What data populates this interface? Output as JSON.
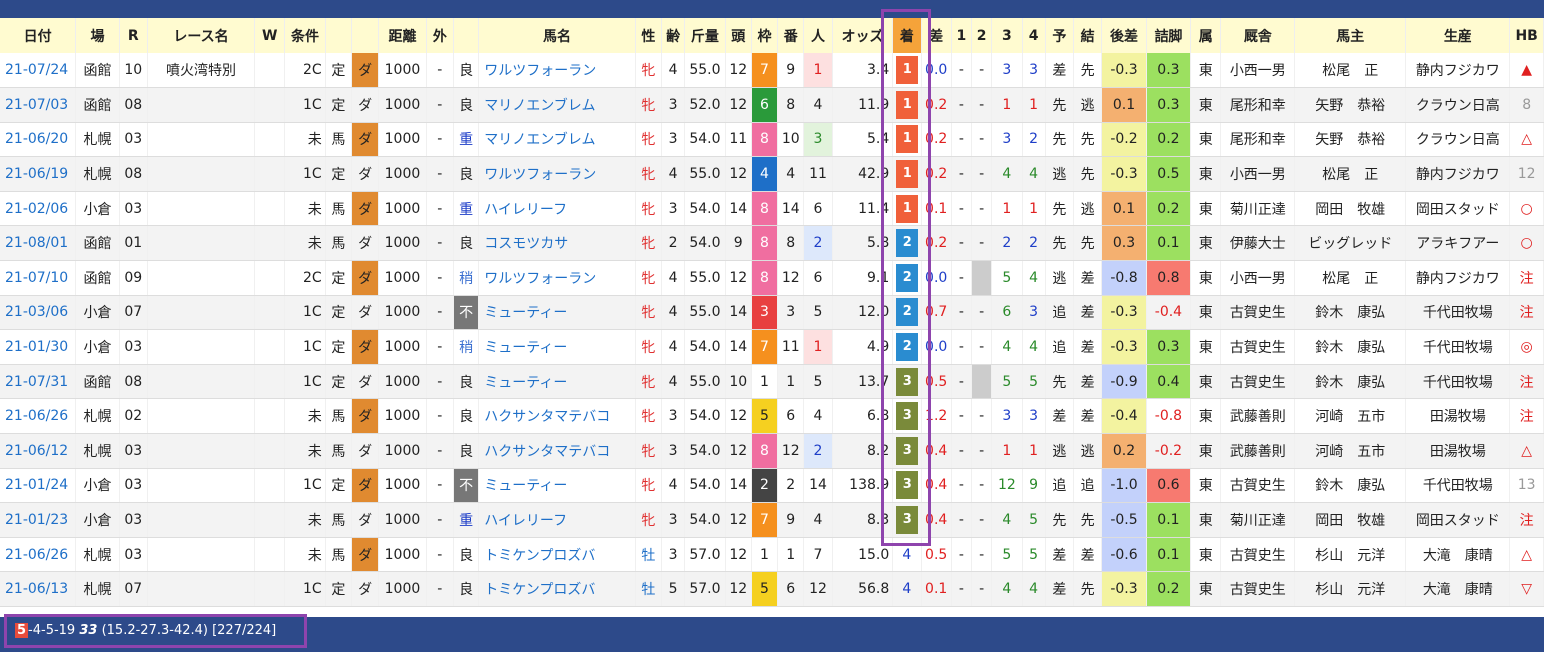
{
  "headers": [
    "日付",
    "場",
    "R",
    "レース名",
    "W",
    "条件",
    "",
    "",
    "距離",
    "外",
    "",
    "馬名",
    "性",
    "齢",
    "斤量",
    "頭",
    "枠",
    "番",
    "人",
    "オッズ",
    "着",
    "差",
    "1",
    "2",
    "3",
    "4",
    "予",
    "結",
    "後差",
    "詰脚",
    "属",
    "厩舎",
    "馬主",
    "生産",
    "HB"
  ],
  "rows": [
    {
      "date": "21-07/24",
      "venue": "函館",
      "r": "10",
      "race": "噴火湾特別",
      "w": "",
      "cls": "2C",
      "kind": "定",
      "surf": "ダ",
      "dist": "1000",
      "out": "-",
      "cond": "良",
      "horse": "ワルツフォーラン",
      "sex": "牝",
      "age": "4",
      "wt": "55.0",
      "n": "12",
      "waku": "7",
      "ban": "9",
      "pop": "1",
      "odds": "3.4",
      "finish": "1",
      "diff": "0.0",
      "c1": "-",
      "c2": "-",
      "c3": "3",
      "c4": "3",
      "yo": "差",
      "ke": "先",
      "ato": "-0.3",
      "tsume": "0.3",
      "zoku": "東",
      "trainer": "小西一男",
      "owner": "松尾　正",
      "breeder": "静内フジカワ",
      "hb": "▲"
    },
    {
      "date": "21-07/03",
      "venue": "函館",
      "r": "08",
      "race": "",
      "w": "",
      "cls": "1C",
      "kind": "定",
      "surf": "ダ",
      "dist": "1000",
      "out": "-",
      "cond": "良",
      "horse": "マリノエンブレム",
      "sex": "牝",
      "age": "3",
      "wt": "52.0",
      "n": "12",
      "waku": "6",
      "ban": "8",
      "pop": "4",
      "odds": "11.9",
      "finish": "1",
      "diff": "0.2",
      "c1": "-",
      "c2": "-",
      "c3": "1",
      "c4": "1",
      "yo": "先",
      "ke": "逃",
      "ato": "0.1",
      "tsume": "0.3",
      "zoku": "東",
      "trainer": "尾形和幸",
      "owner": "矢野　恭裕",
      "breeder": "クラウン日高",
      "hb": "8"
    },
    {
      "date": "21-06/20",
      "venue": "札幌",
      "r": "03",
      "race": "",
      "w": "",
      "cls": "未",
      "kind": "馬",
      "surf": "ダ",
      "dist": "1000",
      "out": "-",
      "cond": "重",
      "horse": "マリノエンブレム",
      "sex": "牝",
      "age": "3",
      "wt": "54.0",
      "n": "11",
      "waku": "8",
      "ban": "10",
      "pop": "3",
      "odds": "5.4",
      "finish": "1",
      "diff": "0.2",
      "c1": "-",
      "c2": "-",
      "c3": "3",
      "c4": "2",
      "yo": "先",
      "ke": "先",
      "ato": "-0.2",
      "tsume": "0.2",
      "zoku": "東",
      "trainer": "尾形和幸",
      "owner": "矢野　恭裕",
      "breeder": "クラウン日高",
      "hb": "△"
    },
    {
      "date": "21-06/19",
      "venue": "札幌",
      "r": "08",
      "race": "",
      "w": "",
      "cls": "1C",
      "kind": "定",
      "surf": "ダ",
      "dist": "1000",
      "out": "-",
      "cond": "良",
      "horse": "ワルツフォーラン",
      "sex": "牝",
      "age": "4",
      "wt": "55.0",
      "n": "12",
      "waku": "4",
      "ban": "4",
      "pop": "11",
      "odds": "42.9",
      "finish": "1",
      "diff": "0.2",
      "c1": "-",
      "c2": "-",
      "c3": "4",
      "c4": "4",
      "yo": "逃",
      "ke": "先",
      "ato": "-0.3",
      "tsume": "0.5",
      "zoku": "東",
      "trainer": "小西一男",
      "owner": "松尾　正",
      "breeder": "静内フジカワ",
      "hb": "12"
    },
    {
      "date": "21-02/06",
      "venue": "小倉",
      "r": "03",
      "race": "",
      "w": "",
      "cls": "未",
      "kind": "馬",
      "surf": "ダ",
      "dist": "1000",
      "out": "-",
      "cond": "重",
      "horse": "ハイレリーフ",
      "sex": "牝",
      "age": "3",
      "wt": "54.0",
      "n": "14",
      "waku": "8",
      "ban": "14",
      "pop": "6",
      "odds": "11.4",
      "finish": "1",
      "diff": "0.1",
      "c1": "-",
      "c2": "-",
      "c3": "1",
      "c4": "1",
      "yo": "先",
      "ke": "逃",
      "ato": "0.1",
      "tsume": "0.2",
      "zoku": "東",
      "trainer": "菊川正達",
      "owner": "岡田　牧雄",
      "breeder": "岡田スタッド",
      "hb": "○"
    },
    {
      "date": "21-08/01",
      "venue": "函館",
      "r": "01",
      "race": "",
      "w": "",
      "cls": "未",
      "kind": "馬",
      "surf": "ダ",
      "dist": "1000",
      "out": "-",
      "cond": "良",
      "horse": "コスモツカサ",
      "sex": "牝",
      "age": "2",
      "wt": "54.0",
      "n": "9",
      "waku": "8",
      "ban": "8",
      "pop": "2",
      "odds": "5.8",
      "finish": "2",
      "diff": "0.2",
      "c1": "-",
      "c2": "-",
      "c3": "2",
      "c4": "2",
      "yo": "先",
      "ke": "先",
      "ato": "0.3",
      "tsume": "0.1",
      "zoku": "東",
      "trainer": "伊藤大士",
      "owner": "ビッグレッド",
      "breeder": "アラキフアー",
      "hb": "○"
    },
    {
      "date": "21-07/10",
      "venue": "函館",
      "r": "09",
      "race": "",
      "w": "",
      "cls": "2C",
      "kind": "定",
      "surf": "ダ",
      "dist": "1000",
      "out": "-",
      "cond": "稍",
      "horse": "ワルツフォーラン",
      "sex": "牝",
      "age": "4",
      "wt": "55.0",
      "n": "12",
      "waku": "8",
      "ban": "12",
      "pop": "6",
      "odds": "9.1",
      "finish": "2",
      "diff": "0.0",
      "c1": "-",
      "c2": "",
      "c3": "5",
      "c4": "4",
      "yo": "逃",
      "ke": "差",
      "ato": "-0.8",
      "tsume": "0.8",
      "zoku": "東",
      "trainer": "小西一男",
      "owner": "松尾　正",
      "breeder": "静内フジカワ",
      "hb": "注"
    },
    {
      "date": "21-03/06",
      "venue": "小倉",
      "r": "07",
      "race": "",
      "w": "",
      "cls": "1C",
      "kind": "定",
      "surf": "ダ",
      "dist": "1000",
      "out": "-",
      "cond": "不",
      "horse": "ミューティー",
      "sex": "牝",
      "age": "4",
      "wt": "55.0",
      "n": "14",
      "waku": "3",
      "ban": "3",
      "pop": "5",
      "odds": "12.0",
      "finish": "2",
      "diff": "0.7",
      "c1": "-",
      "c2": "-",
      "c3": "6",
      "c4": "3",
      "yo": "追",
      "ke": "差",
      "ato": "-0.3",
      "tsume": "-0.4",
      "zoku": "東",
      "trainer": "古賀史生",
      "owner": "鈴木　康弘",
      "breeder": "千代田牧場",
      "hb": "注"
    },
    {
      "date": "21-01/30",
      "venue": "小倉",
      "r": "03",
      "race": "",
      "w": "",
      "cls": "1C",
      "kind": "定",
      "surf": "ダ",
      "dist": "1000",
      "out": "-",
      "cond": "稍",
      "horse": "ミューティー",
      "sex": "牝",
      "age": "4",
      "wt": "54.0",
      "n": "14",
      "waku": "7",
      "ban": "11",
      "pop": "1",
      "odds": "4.9",
      "finish": "2",
      "diff": "0.0",
      "c1": "-",
      "c2": "-",
      "c3": "4",
      "c4": "4",
      "yo": "追",
      "ke": "差",
      "ato": "-0.3",
      "tsume": "0.3",
      "zoku": "東",
      "trainer": "古賀史生",
      "owner": "鈴木　康弘",
      "breeder": "千代田牧場",
      "hb": "◎"
    },
    {
      "date": "21-07/31",
      "venue": "函館",
      "r": "08",
      "race": "",
      "w": "",
      "cls": "1C",
      "kind": "定",
      "surf": "ダ",
      "dist": "1000",
      "out": "-",
      "cond": "良",
      "horse": "ミューティー",
      "sex": "牝",
      "age": "4",
      "wt": "55.0",
      "n": "10",
      "waku": "1",
      "ban": "1",
      "pop": "5",
      "odds": "13.7",
      "finish": "3",
      "diff": "0.5",
      "c1": "-",
      "c2": "",
      "c3": "5",
      "c4": "5",
      "yo": "先",
      "ke": "差",
      "ato": "-0.9",
      "tsume": "0.4",
      "zoku": "東",
      "trainer": "古賀史生",
      "owner": "鈴木　康弘",
      "breeder": "千代田牧場",
      "hb": "注"
    },
    {
      "date": "21-06/26",
      "venue": "札幌",
      "r": "02",
      "race": "",
      "w": "",
      "cls": "未",
      "kind": "馬",
      "surf": "ダ",
      "dist": "1000",
      "out": "-",
      "cond": "良",
      "horse": "ハクサンタマテバコ",
      "sex": "牝",
      "age": "3",
      "wt": "54.0",
      "n": "12",
      "waku": "5",
      "ban": "6",
      "pop": "4",
      "odds": "6.8",
      "finish": "3",
      "diff": "1.2",
      "c1": "-",
      "c2": "-",
      "c3": "3",
      "c4": "3",
      "yo": "差",
      "ke": "差",
      "ato": "-0.4",
      "tsume": "-0.8",
      "zoku": "東",
      "trainer": "武藤善則",
      "owner": "河崎　五市",
      "breeder": "田湯牧場",
      "hb": "注"
    },
    {
      "date": "21-06/12",
      "venue": "札幌",
      "r": "03",
      "race": "",
      "w": "",
      "cls": "未",
      "kind": "馬",
      "surf": "ダ",
      "dist": "1000",
      "out": "-",
      "cond": "良",
      "horse": "ハクサンタマテバコ",
      "sex": "牝",
      "age": "3",
      "wt": "54.0",
      "n": "12",
      "waku": "8",
      "ban": "12",
      "pop": "2",
      "odds": "8.2",
      "finish": "3",
      "diff": "0.4",
      "c1": "-",
      "c2": "-",
      "c3": "1",
      "c4": "1",
      "yo": "逃",
      "ke": "逃",
      "ato": "0.2",
      "tsume": "-0.2",
      "zoku": "東",
      "trainer": "武藤善則",
      "owner": "河崎　五市",
      "breeder": "田湯牧場",
      "hb": "△"
    },
    {
      "date": "21-01/24",
      "venue": "小倉",
      "r": "03",
      "race": "",
      "w": "",
      "cls": "1C",
      "kind": "定",
      "surf": "ダ",
      "dist": "1000",
      "out": "-",
      "cond": "不",
      "horse": "ミューティー",
      "sex": "牝",
      "age": "4",
      "wt": "54.0",
      "n": "14",
      "waku": "2",
      "ban": "2",
      "pop": "14",
      "odds": "138.9",
      "finish": "3",
      "diff": "0.4",
      "c1": "-",
      "c2": "-",
      "c3": "12",
      "c4": "9",
      "yo": "追",
      "ke": "追",
      "ato": "-1.0",
      "tsume": "0.6",
      "zoku": "東",
      "trainer": "古賀史生",
      "owner": "鈴木　康弘",
      "breeder": "千代田牧場",
      "hb": "13"
    },
    {
      "date": "21-01/23",
      "venue": "小倉",
      "r": "03",
      "race": "",
      "w": "",
      "cls": "未",
      "kind": "馬",
      "surf": "ダ",
      "dist": "1000",
      "out": "-",
      "cond": "重",
      "horse": "ハイレリーフ",
      "sex": "牝",
      "age": "3",
      "wt": "54.0",
      "n": "12",
      "waku": "7",
      "ban": "9",
      "pop": "4",
      "odds": "8.3",
      "finish": "3",
      "diff": "0.4",
      "c1": "-",
      "c2": "-",
      "c3": "4",
      "c4": "5",
      "yo": "先",
      "ke": "先",
      "ato": "-0.5",
      "tsume": "0.1",
      "zoku": "東",
      "trainer": "菊川正達",
      "owner": "岡田　牧雄",
      "breeder": "岡田スタッド",
      "hb": "注"
    },
    {
      "date": "21-06/26",
      "venue": "札幌",
      "r": "03",
      "race": "",
      "w": "",
      "cls": "未",
      "kind": "馬",
      "surf": "ダ",
      "dist": "1000",
      "out": "-",
      "cond": "良",
      "horse": "トミケンプロズバ",
      "sex": "牡",
      "age": "3",
      "wt": "57.0",
      "n": "12",
      "waku": "1",
      "ban": "1",
      "pop": "7",
      "odds": "15.0",
      "finish": "4",
      "diff": "0.5",
      "c1": "-",
      "c2": "-",
      "c3": "5",
      "c4": "5",
      "yo": "差",
      "ke": "差",
      "ato": "-0.6",
      "tsume": "0.1",
      "zoku": "東",
      "trainer": "古賀史生",
      "owner": "杉山　元洋",
      "breeder": "大滝　康晴",
      "hb": "△"
    },
    {
      "date": "21-06/13",
      "venue": "札幌",
      "r": "07",
      "race": "",
      "w": "",
      "cls": "1C",
      "kind": "定",
      "surf": "ダ",
      "dist": "1000",
      "out": "-",
      "cond": "良",
      "horse": "トミケンプロズバ",
      "sex": "牡",
      "age": "5",
      "wt": "57.0",
      "n": "12",
      "waku": "5",
      "ban": "6",
      "pop": "12",
      "odds": "56.8",
      "finish": "4",
      "diff": "0.1",
      "c1": "-",
      "c2": "-",
      "c3": "4",
      "c4": "4",
      "yo": "差",
      "ke": "先",
      "ato": "-0.3",
      "tsume": "0.2",
      "zoku": "東",
      "trainer": "古賀史生",
      "owner": "杉山　元洋",
      "breeder": "大滝　康晴",
      "hb": "▽"
    }
  ],
  "summary": {
    "first": "5",
    "rest": "-4-5-19",
    "total": "33",
    "detail": "(15.2-27.3-42.4) [227/224]"
  },
  "colors": {
    "header_bg": "#fffbd0",
    "bar": "#2d4a8a",
    "highlight": "#8e44ad",
    "first": "#f0603a",
    "second": "#2a8cd0",
    "third": "#7a8a3a"
  }
}
